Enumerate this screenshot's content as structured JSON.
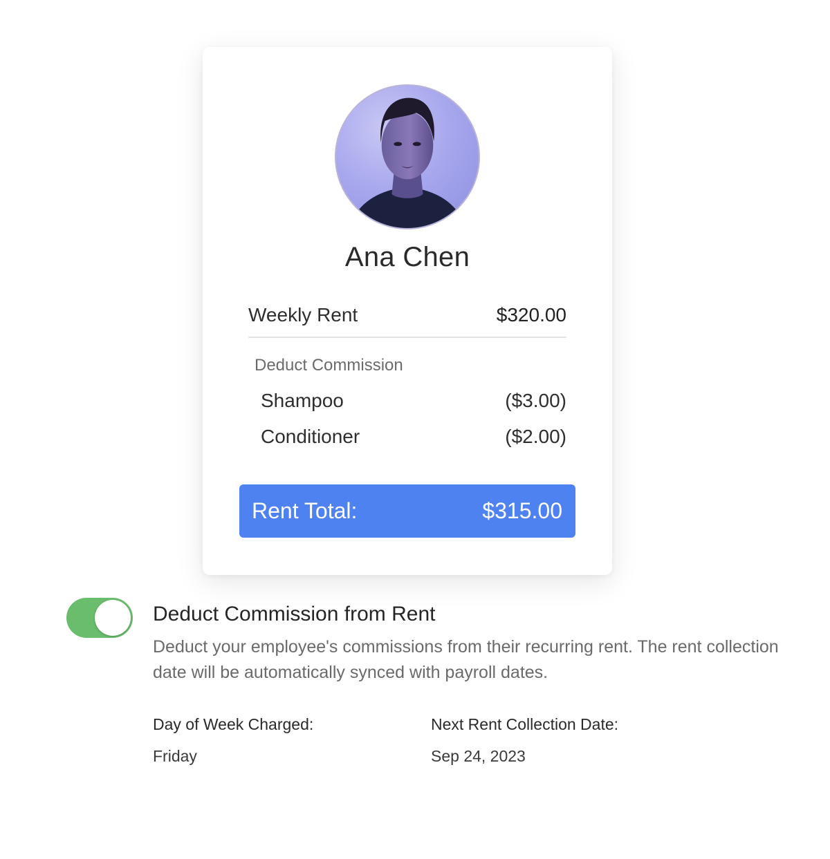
{
  "card": {
    "avatar_alt": "Ana Chen",
    "name": "Ana Chen",
    "weekly_rent": {
      "label": "Weekly Rent",
      "amount": "$320.00"
    },
    "deduct_label": "Deduct Commission",
    "items": [
      {
        "label": "Shampoo",
        "amount": "($3.00)"
      },
      {
        "label": "Conditioner",
        "amount": "($2.00)"
      }
    ],
    "total": {
      "label": "Rent Total:",
      "amount": "$315.00",
      "color": "#4f82f1"
    }
  },
  "setting": {
    "toggle_on": true,
    "toggle_color": "#6bbd6e",
    "title": "Deduct Commission from Rent",
    "description": "Deduct your employee's commissions from their recurring rent. The rent collection date will be automatically synced with payroll dates.",
    "day_label": "Day of Week Charged:",
    "day_value": "Friday",
    "next_label": "Next Rent Collection Date:",
    "next_value": "Sep 24, 2023"
  }
}
